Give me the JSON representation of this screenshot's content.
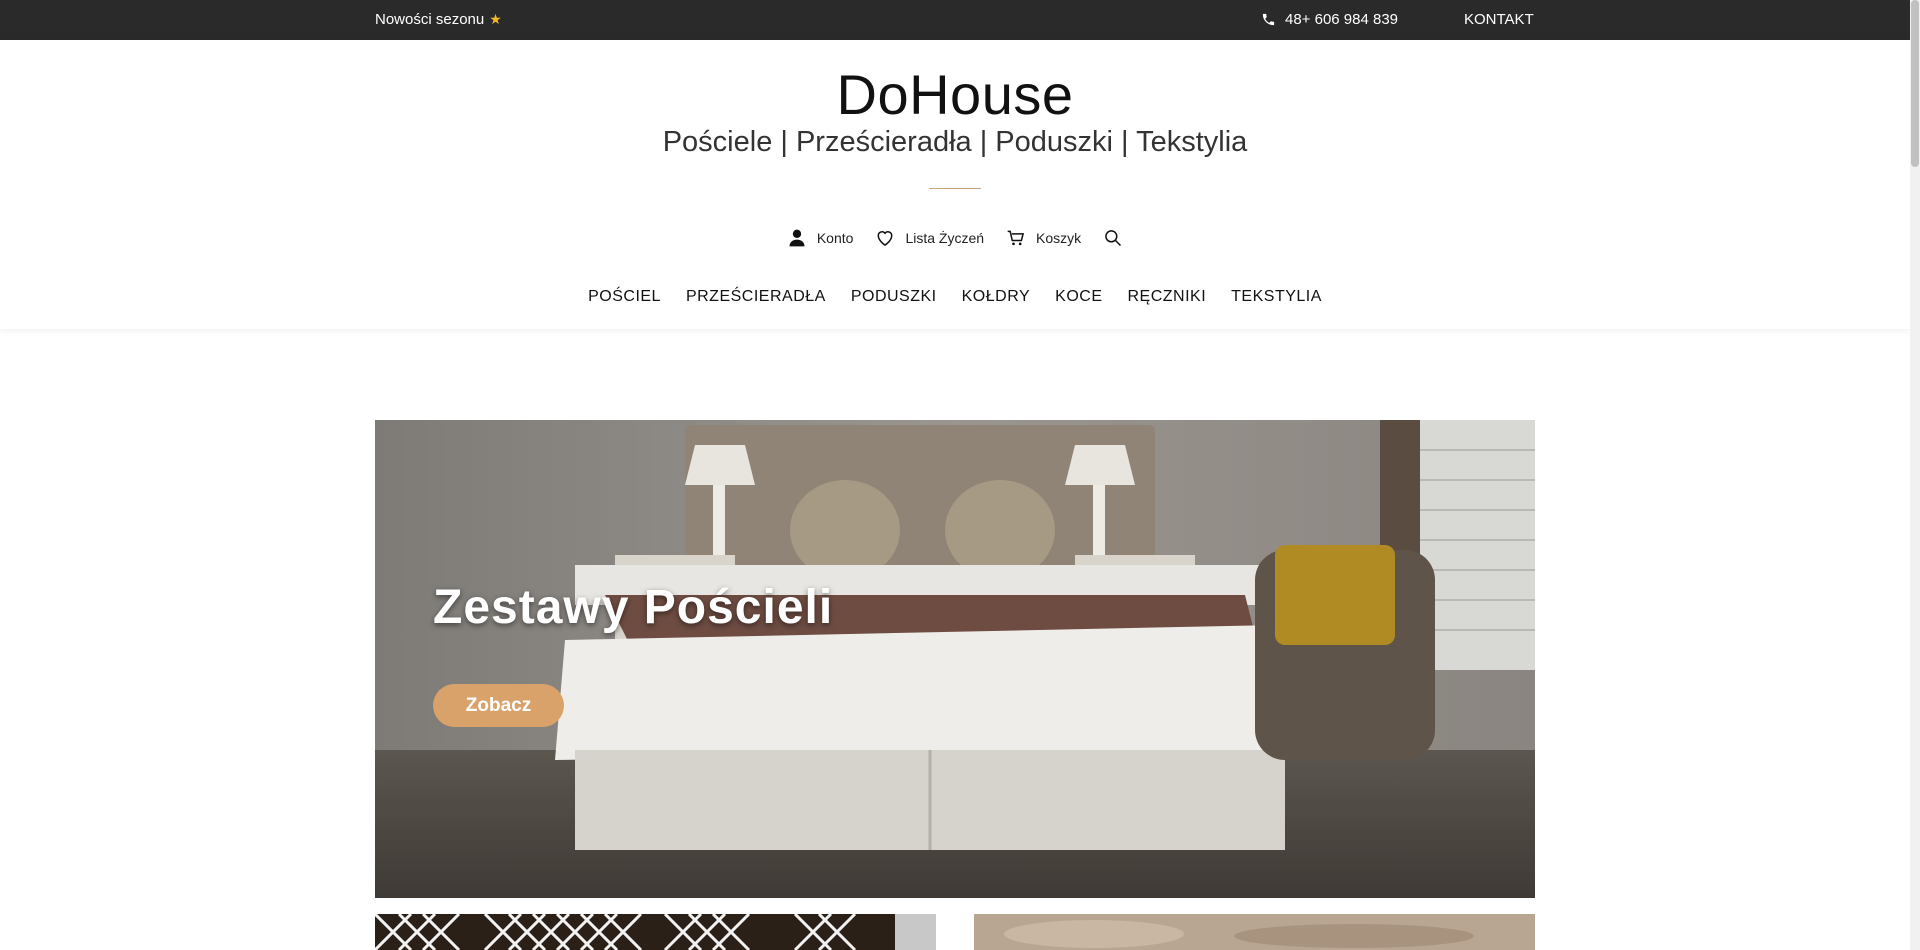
{
  "topbar": {
    "promo_label": "Nowości sezonu",
    "promo_star": "★",
    "phone": "48+ 606 984 839",
    "contact_label": "KONTAKT"
  },
  "header": {
    "logo": "DoHouse",
    "tagline": "Pościele | Prześcieradła | Poduszki | Tekstylia",
    "accent_color": "#c9a67a"
  },
  "utility": {
    "account_label": "Konto",
    "wishlist_label": "Lista Życzeń",
    "cart_label": "Koszyk"
  },
  "nav": {
    "items": [
      "POŚCIEL",
      "PRZEŚCIERADŁA",
      "PODUSZKI",
      "KOŁDRY",
      "KOCE",
      "RĘCZNIKI",
      "TEKSTYLIA"
    ]
  },
  "hero": {
    "title": "Zestawy Pościeli",
    "cta_label": "Zobacz",
    "cta_color": "#d8a26a"
  },
  "icons": {
    "phone": "phone-icon",
    "account": "user-icon",
    "wishlist": "heart-icon",
    "cart": "cart-icon",
    "search": "search-icon",
    "promo": "star-icon"
  }
}
